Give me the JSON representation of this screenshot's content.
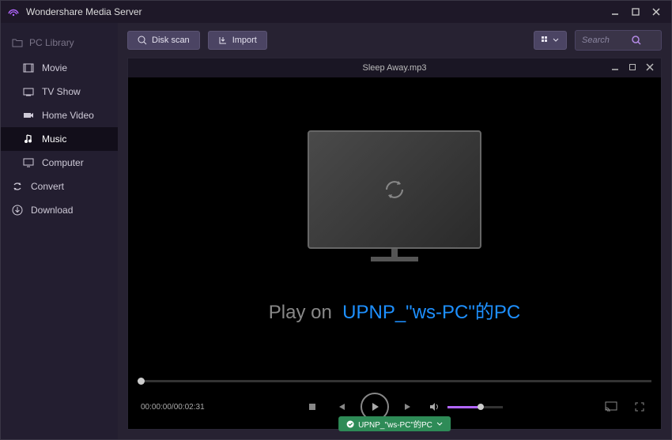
{
  "app": {
    "title": "Wondershare Media Server"
  },
  "sidebar": {
    "header": "PC Library",
    "items": [
      {
        "label": "Movie"
      },
      {
        "label": "TV Show"
      },
      {
        "label": "Home Video"
      },
      {
        "label": "Music"
      },
      {
        "label": "Computer"
      }
    ],
    "convert": "Convert",
    "download": "Download"
  },
  "toolbar": {
    "disk_scan": "Disk scan",
    "import": "Import",
    "search_placeholder": "Search"
  },
  "player": {
    "title": "Sleep Away.mp3",
    "play_on_label": "Play on",
    "device_name": "UPNP_\"ws-PC\"的PC",
    "time": "00:00:00/00:02:31"
  },
  "footer": {
    "device_badge": "UPNP_\"ws-PC\"的PC"
  }
}
